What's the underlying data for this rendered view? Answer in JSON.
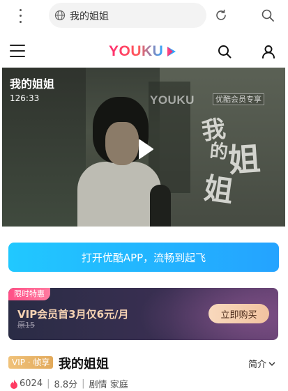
{
  "browser": {
    "url_text": "我的姐姐"
  },
  "header": {
    "logo_text": "YOUKU"
  },
  "video": {
    "title": "我的姐姐",
    "duration": "126:33",
    "watermark": "YOUKU",
    "badge": "优酷会员专享",
    "calligraphy": [
      "我",
      "的",
      "姐",
      "姐"
    ]
  },
  "open_app": {
    "label": "打开优酷APP，流畅到起飞"
  },
  "vip_promo": {
    "tag": "限时特惠",
    "offer": "VIP会员首3月仅6元/月",
    "original_price": "原15",
    "buy_label": "立即购买"
  },
  "show": {
    "vip_badge": "VIP · 帧享",
    "title": "我的姐姐",
    "intro_label": "简介",
    "heat": "6024",
    "score": "8.8分",
    "genres": "剧情 家庭"
  },
  "colors": {
    "accent_blue": "#24a3ff",
    "logo_pink": "#ff2d6f",
    "vip_gold": "#e2a95a"
  },
  "icons": [
    "kebab-menu-icon",
    "globe-icon",
    "reload-icon",
    "search-icon",
    "hamburger-menu-icon",
    "user-icon",
    "play-icon",
    "flame-icon",
    "chevron-down-icon"
  ]
}
